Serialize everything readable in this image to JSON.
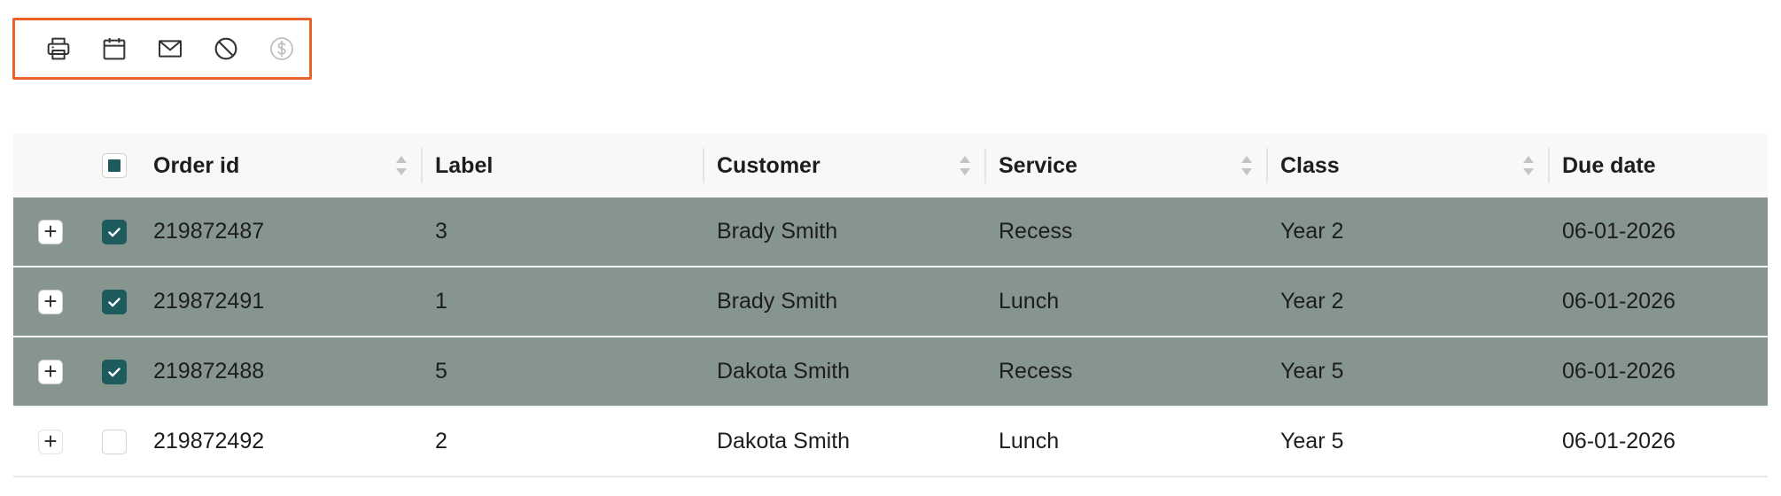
{
  "toolbar": {
    "accent_color": "#e8622a",
    "buttons": [
      {
        "icon": "printer-icon"
      },
      {
        "icon": "calendar-icon"
      },
      {
        "icon": "mail-icon"
      },
      {
        "icon": "block-icon"
      },
      {
        "icon": "dollar-icon",
        "disabled": true
      }
    ]
  },
  "table": {
    "columns": {
      "order_id": "Order id",
      "label": "Label",
      "customer": "Customer",
      "service": "Service",
      "class": "Class",
      "due_date": "Due date"
    },
    "selected_row_color": "#87958f",
    "checkbox_color": "#1e5b5c",
    "rows": [
      {
        "order_id": "219872487",
        "label": "3",
        "customer": "Brady Smith",
        "service": "Recess",
        "class": "Year 2",
        "due_date": "06-01-2026",
        "checked": true
      },
      {
        "order_id": "219872491",
        "label": "1",
        "customer": "Brady Smith",
        "service": "Lunch",
        "class": "Year 2",
        "due_date": "06-01-2026",
        "checked": true
      },
      {
        "order_id": "219872488",
        "label": "5",
        "customer": "Dakota Smith",
        "service": "Recess",
        "class": "Year 5",
        "due_date": "06-01-2026",
        "checked": true
      },
      {
        "order_id": "219872492",
        "label": "2",
        "customer": "Dakota Smith",
        "service": "Lunch",
        "class": "Year 5",
        "due_date": "06-01-2026",
        "checked": false
      }
    ]
  }
}
